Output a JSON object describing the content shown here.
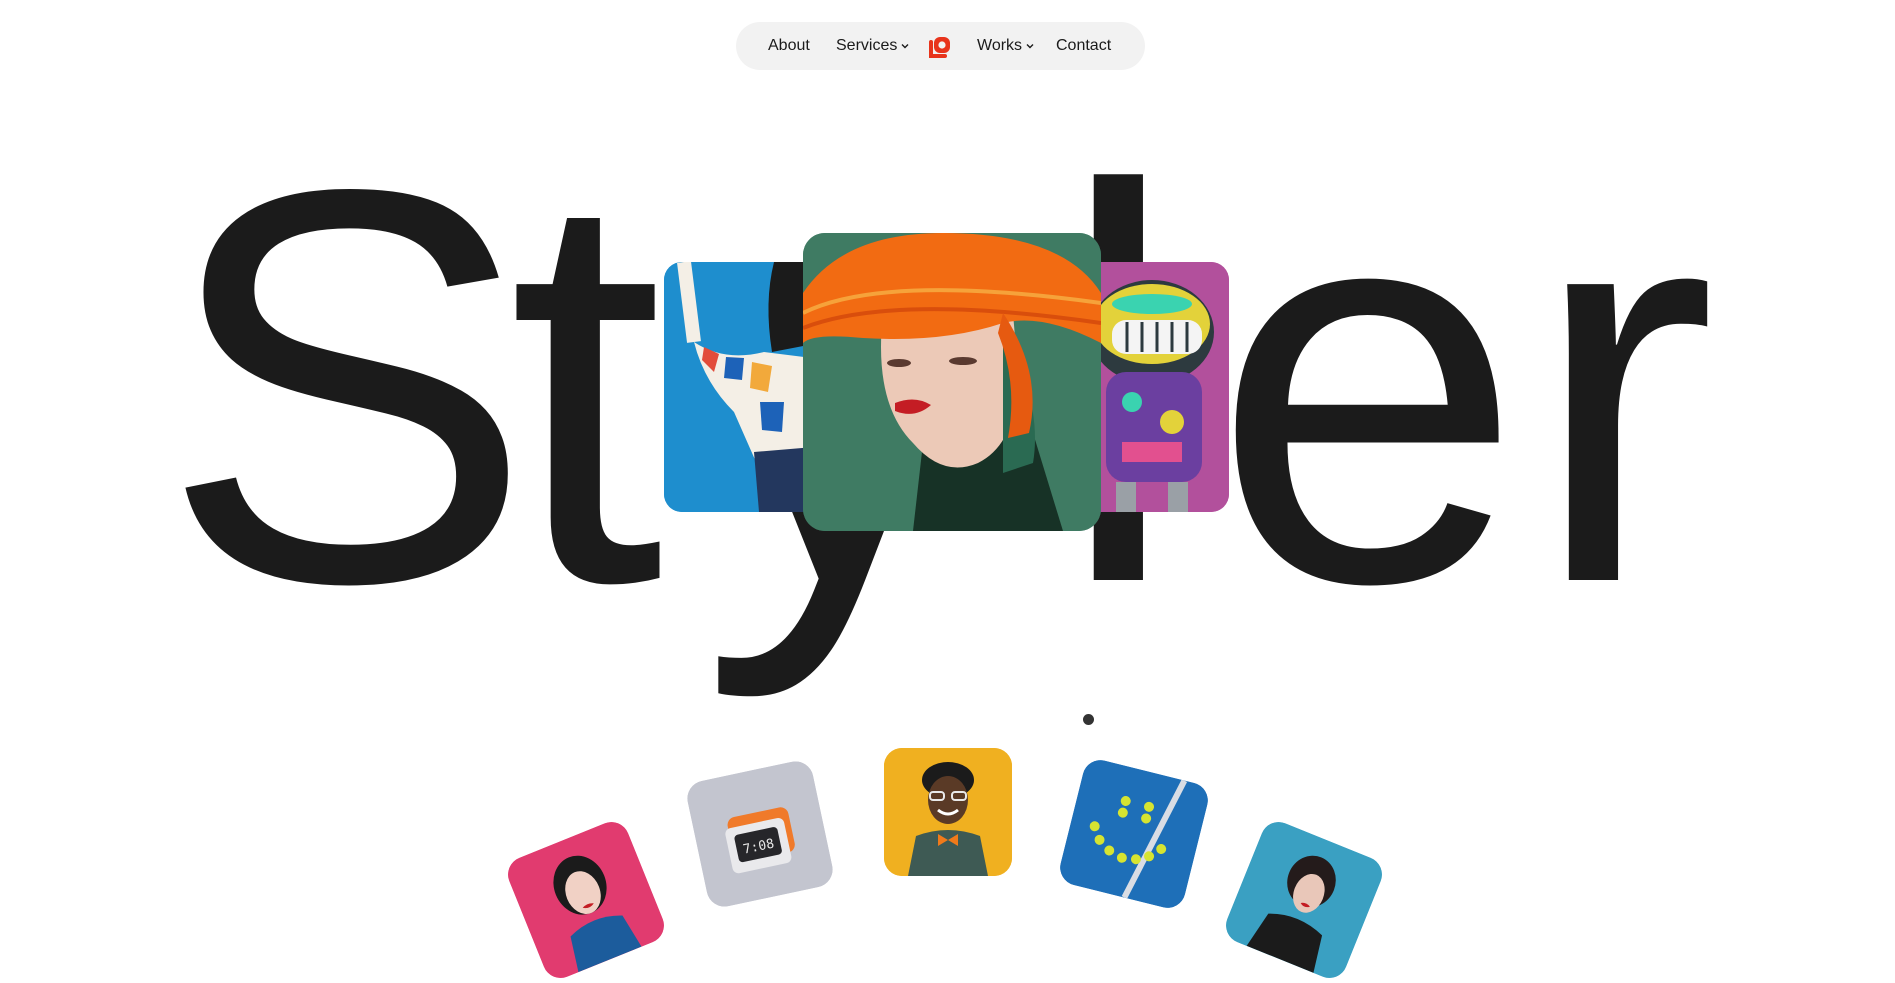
{
  "nav": {
    "about": "About",
    "services": "Services",
    "works": "Works",
    "contact": "Contact"
  },
  "hero": {
    "word": "Styler",
    "letters": [
      "S",
      "t",
      "y",
      "l",
      "e",
      "r"
    ]
  },
  "colors": {
    "text": "#1b1b1b",
    "nav_bg": "#f2f2f2",
    "logo": "#e8341c",
    "card_blue": "#1f8fd0",
    "card_green": "#3e7a62",
    "card_orange": "#f26b12",
    "card_magenta": "#b84f9e",
    "tile_pink": "#e13b6f",
    "tile_grey": "#c3c5cf",
    "tile_yellow": "#f0b020",
    "tile_blue": "#1e6fb8",
    "tile_teal": "#3aa0c2"
  },
  "icons": {
    "logo": "styler-logo-icon",
    "dropdown": "chevron-down-icon"
  },
  "gallery": {
    "clock_time": "7:08"
  }
}
